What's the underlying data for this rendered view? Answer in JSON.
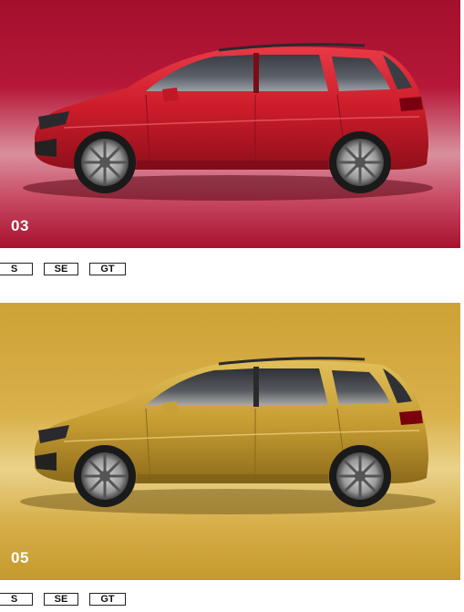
{
  "variants": [
    {
      "number": "03",
      "color": "#b0142f",
      "trims": [
        "S",
        "SE",
        "GT"
      ]
    },
    {
      "number": "05",
      "color": "#d4a934",
      "trims": [
        "S",
        "SE",
        "GT"
      ]
    }
  ]
}
